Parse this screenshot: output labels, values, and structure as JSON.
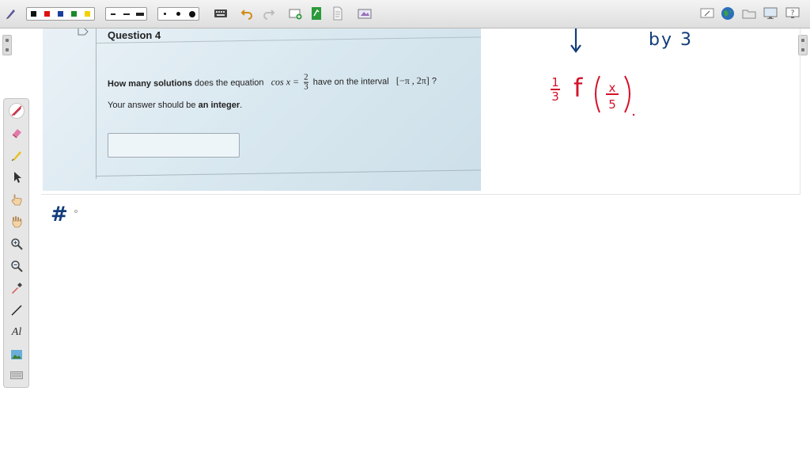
{
  "toolbar": {
    "colors": [
      "#111111",
      "#e01010",
      "#1b3f9a",
      "#1a8a2a",
      "#f2d200"
    ],
    "line_styles": [
      "dash-short",
      "dash-long",
      "solid"
    ],
    "dot_sizes": [
      "small",
      "medium",
      "large"
    ],
    "left_icons": [
      "pen-tool-icon"
    ],
    "mid_icons": [
      "keyboard-icon",
      "undo-icon",
      "redo-icon",
      "add-page-icon",
      "pdf-page-icon",
      "document-icon",
      "screenshot-icon"
    ],
    "right_icons": [
      "whiteboard-icon",
      "globe-icon",
      "folder-icon",
      "monitor-icon",
      "help-icon"
    ]
  },
  "palette": {
    "tools": [
      "pen-icon",
      "eraser-icon",
      "highlighter-icon",
      "pointer-icon",
      "hand-point-icon",
      "hand-pan-icon",
      "zoom-in-icon",
      "zoom-out-icon",
      "eyedropper-icon",
      "line-icon",
      "text-icon",
      "image-icon",
      "keyboard-small-icon"
    ],
    "text_tool_label": "Al"
  },
  "question": {
    "title": "Question 4",
    "prompt_bold": "How many solutions",
    "prompt_middle": "does the equation",
    "cos_expr": "cos x =",
    "frac_num": "2",
    "frac_den": "3",
    "prompt_tail": "have on the interval",
    "interval": "[−π , 2π]",
    "question_mark": "?",
    "hint_prefix": "Your answer should be",
    "hint_bold": "an integer",
    "hint_suffix": "."
  },
  "handwriting": {
    "top_text": "by 3",
    "frac_one": "1",
    "frac_three": "3",
    "func": "f",
    "inner_num": "x",
    "inner_den": "5",
    "hash": "#",
    "colors": {
      "blue_ink": "#123c7a",
      "red_ink": "#d4122a"
    }
  }
}
